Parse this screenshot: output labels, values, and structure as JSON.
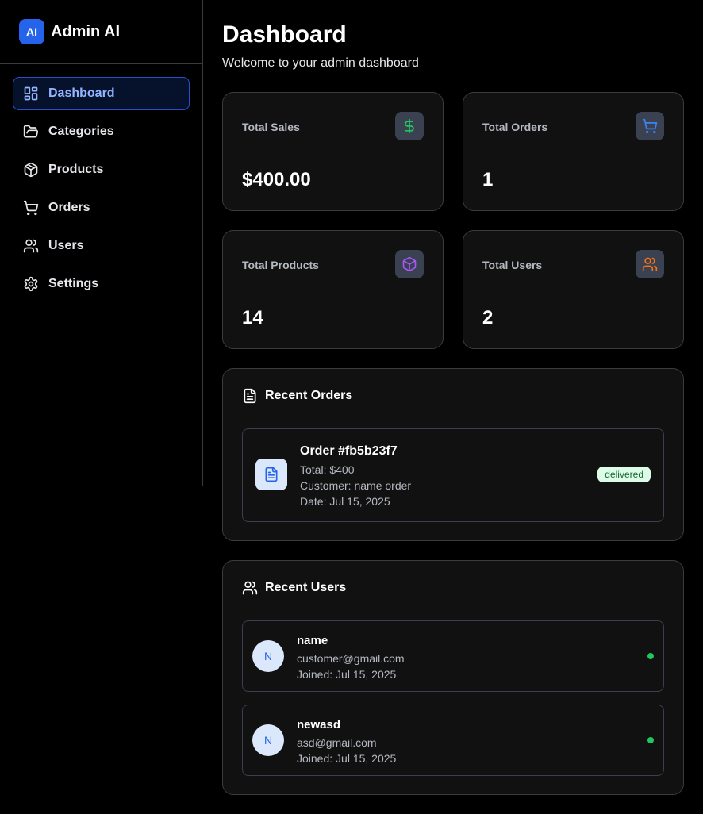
{
  "brand": {
    "logo_text": "AI",
    "name": "Admin AI",
    "accent": "#2563eb"
  },
  "nav": [
    {
      "label": "Dashboard",
      "icon": "dashboard-icon",
      "active": true
    },
    {
      "label": "Categories",
      "icon": "folder-icon"
    },
    {
      "label": "Products",
      "icon": "box-icon"
    },
    {
      "label": "Orders",
      "icon": "cart-icon"
    },
    {
      "label": "Users",
      "icon": "users-icon"
    },
    {
      "label": "Settings",
      "icon": "gear-icon"
    }
  ],
  "header": {
    "title": "Dashboard",
    "subtitle": "Welcome to your admin dashboard"
  },
  "stats": [
    {
      "label": "Total Sales",
      "value": "$400.00",
      "icon": "dollar-icon",
      "color": "#22c55e"
    },
    {
      "label": "Total Orders",
      "value": "1",
      "icon": "cart-icon",
      "color": "#3b82f6"
    },
    {
      "label": "Total Products",
      "value": "14",
      "icon": "box-icon",
      "color": "#a855f7"
    },
    {
      "label": "Total Users",
      "value": "2",
      "icon": "users-icon",
      "color": "#f97316"
    }
  ],
  "recent_orders": {
    "title": "Recent Orders",
    "items": [
      {
        "title": "Order #fb5b23f7",
        "total": "Total: $400",
        "customer": "Customer: name order",
        "date": "Date: Jul 15, 2025",
        "status": "delivered"
      }
    ]
  },
  "recent_users": {
    "title": "Recent Users",
    "items": [
      {
        "initial": "N",
        "name": "name",
        "email": "customer@gmail.com",
        "joined": "Joined: Jul 15, 2025"
      },
      {
        "initial": "N",
        "name": "newasd",
        "email": "asd@gmail.com",
        "joined": "Joined: Jul 15, 2025"
      }
    ]
  }
}
